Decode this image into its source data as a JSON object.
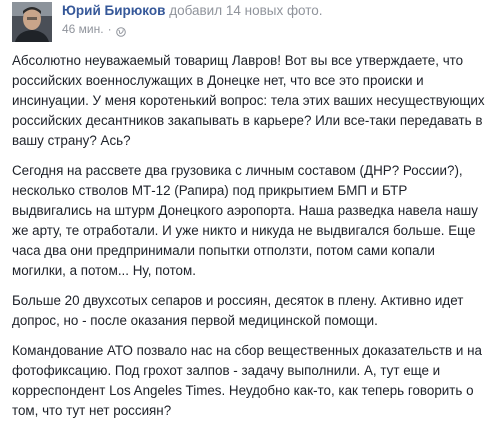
{
  "post": {
    "author": "Юрий Бирюков",
    "action": "добавил 14 новых фото.",
    "time": "46 мин.",
    "icons": {
      "avatar": "profile-photo",
      "privacy": "globe-icon"
    },
    "paragraphs": [
      "Абсолютно неуважаемый товарищ Лавров! Вот вы все утверждаете, что российских военнослужащих в Донецке нет, что все это происки и инсинуации. У меня коротенький вопрос: тела этих ваших несуществующих российских десантников закапывать в карьере? Или все-таки передавать в вашу страну? Ась?",
      "Сегодня на рассвете два грузовика с личным составом (ДНР? России?), несколько стволов МТ-12 (Рапира) под прикрытием БМП и БТР выдвигались на штурм Донецкого аэропорта. Наша разведка навела нашу же арту, те отработали. И уже никто и никуда не выдвигался больше. Еще часа два они предпринимали попытки отползти, потом сами копали могилки, а потом... Ну, потом.",
      "Больше 20 двухсотых сепаров и россиян, десяток в плену. Активно идет допрос, но - после оказания первой медицинской помощи.",
      "Командование АТО позвало нас на сбор вещественных доказательств и на фотофиксацию. Под грохот залпов - задачу выполнили. А, тут еще и корреспондент Los Angeles Times. Неудобно как-то, как теперь говорить о том, что тут нет россиян?"
    ]
  }
}
